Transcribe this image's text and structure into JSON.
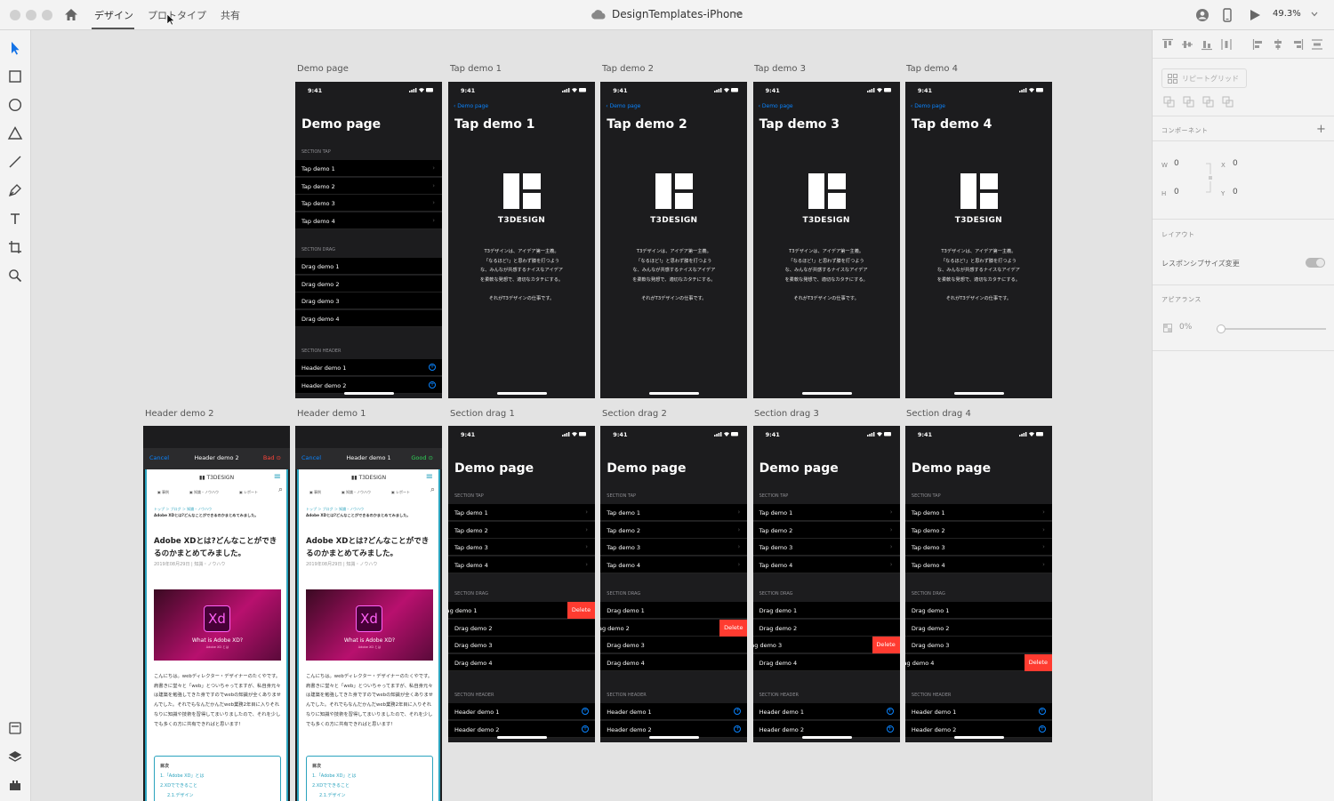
{
  "app": {
    "tabs": [
      "デザイン",
      "プロトタイプ",
      "共有"
    ],
    "document_title": "DesignTemplates-iPhone",
    "zoom": "49.3%"
  },
  "panel": {
    "repeat_grid": "リピートグリッド",
    "component_label": "コンポーネント",
    "w_label": "W",
    "w_value": "0",
    "x_label": "X",
    "x_value": "0",
    "h_label": "H",
    "h_value": "0",
    "y_label": "Y",
    "y_value": "0",
    "layout_label": "レイアウト",
    "responsive_resize": "レスポンシブサイズ変更",
    "appearance_label": "アピアランス",
    "opacity_value": "0%",
    "opacity_fraction": 0
  },
  "phone": {
    "time": "9:41",
    "back": "Demo page",
    "demo_title": "Demo page",
    "section_tap": "SECTION TAP",
    "section_drag": "SECTION DRAG",
    "section_header": "SECTION HEADER",
    "tap_items": [
      "Tap demo 1",
      "Tap demo 2",
      "Tap demo 3",
      "Tap demo 4"
    ],
    "drag_items": [
      "Drag demo 1",
      "Drag demo 2",
      "Drag demo 3",
      "Drag demo 4"
    ],
    "header_items": [
      "Header demo 1",
      "Header demo 2"
    ],
    "delete": "Delete",
    "brand": "T3DESIGN",
    "description": "T3デザインは、アイデア第一主義。\n「なるほど!」と思わず膝を打つよう\nな、みんなが共感するナイスなアイデア\nを柔軟な発想で、適切なカタチにする。\n\nそれがT3デザインの仕事です。"
  },
  "artboards": {
    "row1": [
      "Demo page",
      "Tap demo 1",
      "Tap demo 2",
      "Tap demo 3",
      "Tap demo 4"
    ],
    "row2": [
      "Header demo 2",
      "Header demo 1",
      "Section drag 1",
      "Section drag 2",
      "Section drag 3",
      "Section drag 4"
    ]
  },
  "tap_titles": [
    "Tap demo 1",
    "Tap demo 2",
    "Tap demo 3",
    "Tap demo 4"
  ],
  "header": {
    "cancel": "Cancel",
    "bad": "Bad",
    "good": "Good",
    "title2": "Header demo 2",
    "title1": "Header demo 1",
    "site": "T3DESIGN",
    "nav": [
      "事例",
      "知識・ノウハウ",
      "レポート"
    ],
    "breadcrumb": "トップ ＞ ブログ ＞ 知識・ノウハウ",
    "subtitle": "Adobe XDとは?どんなことができるのかまとめてみました。",
    "article_title": "Adobe XDとは?どんなことができるのかまとめてみました。",
    "date": "2019年08月29日 | 知識・ノウハウ",
    "hero_logo": "Xd",
    "hero_title": "What is Adobe XD?",
    "hero_sub": "Adobe XD とは",
    "body": "こんにちは。webディレクター・デザイナーのたくやです。肩書きに堂々と「web」とついちゃってますが、私自身元々は建築を勉強してきた身ですのでwebの知識が全くありませんでした。それでもなんだかんだweb業務2年目に入りそれなりに知識や技術を習得してまいりましたので、それを少しでも多くの方に共有できればと思います!",
    "toc_title": "目次",
    "toc": [
      "1.「Adobe XD」とは",
      "2.XDでできること",
      "2.1.デザイン"
    ]
  }
}
